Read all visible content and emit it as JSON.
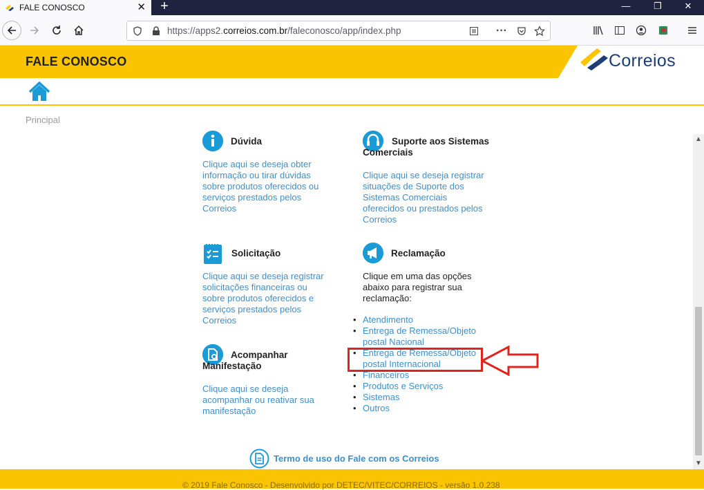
{
  "browser": {
    "tab_title": "FALE CONOSCO",
    "tab_close": "✕",
    "new_tab": "+",
    "url_prefix": "https://apps2.",
    "url_domain": "correios.com.br",
    "url_path": "/faleconosco/app/index.php",
    "win_min": "—",
    "win_restore": "❐",
    "win_close": "✕"
  },
  "header": {
    "title": "FALE CONOSCO",
    "logo_text": "Correios"
  },
  "breadcrumb": "Principal",
  "sections": {
    "duvida": {
      "title": "Dúvida",
      "desc": [
        "Clique aqui se deseja obter",
        "informação ou tirar dúvidas",
        "sobre produtos oferecidos ou",
        "serviços prestados pelos",
        "Correios"
      ]
    },
    "suporte": {
      "title_line1": "Suporte aos Sistemas",
      "title_line2": "Comerciais",
      "desc": [
        "Clique aqui se deseja registrar",
        "situações de Suporte dos",
        "Sistemas Comerciais",
        "oferecidos ou prestados pelos",
        "Correios"
      ]
    },
    "solicitacao": {
      "title": "Solicitação",
      "desc": [
        "Clique aqui se deseja registrar",
        "solicitações financeiras ou",
        "sobre produtos oferecidos e",
        "serviços prestados pelos",
        "Correios"
      ]
    },
    "reclamacao": {
      "title": "Reclamação",
      "desc": [
        "Clique em uma das opções",
        "abaixo para registrar sua",
        "reclamação:"
      ],
      "items": [
        [
          "Atendimento"
        ],
        [
          "Entrega de Remessa/Objeto",
          "postal Nacional"
        ],
        [
          "Entrega de Remessa/Objeto",
          "postal Internacional"
        ],
        [
          "Financeiros"
        ],
        [
          "Produtos e Serviços"
        ],
        [
          "Sistemas"
        ],
        [
          "Outros"
        ]
      ]
    },
    "acompanhar": {
      "title_line1": "Acompanhar",
      "title_line2": "Manifestação",
      "desc": [
        "Clique aqui se deseja",
        "acompanhar ou reativar sua",
        "manifestação"
      ]
    }
  },
  "termo": "Termo de uso do Fale com os Correios",
  "footer": "© 2019 Fale Conosco - Desenvolvido por DETEC/VITEC/CORREIOS - versão 1.0.238",
  "colors": {
    "yellow": "#fbc400",
    "link_blue": "#3d8fc9",
    "icon_blue": "#1a9bd8",
    "highlight_red": "#e0231d"
  }
}
